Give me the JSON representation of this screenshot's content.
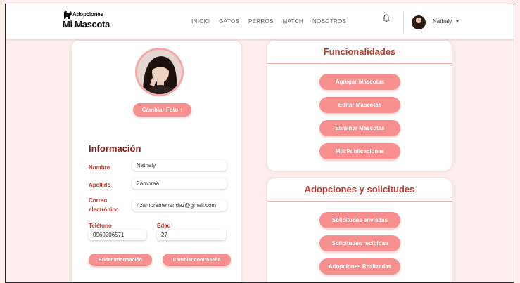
{
  "header": {
    "logo_top": "Adopciones",
    "logo_main": "Mi Mascota",
    "nav": [
      "INICIO",
      "GATOS",
      "PERROS",
      "MATCH",
      "NOSOTROS"
    ],
    "username": "Nathaly",
    "caret": "▾"
  },
  "profile": {
    "change_photo": "Cambiar Foto ↑",
    "section_title": "Información",
    "fields": {
      "nombre_label": "Nombre",
      "nombre_value": "Nathaly",
      "apellido_label": "Apellido",
      "apellido_value": "Zamoraa",
      "correo_label": "Correo electrónico",
      "correo_value": "nzamoramenendez@gmail.com",
      "telefono_label": "Teléfono",
      "telefono_value": "0960206571",
      "edad_label": "Edad",
      "edad_value": "27"
    },
    "edit_button": "Editar Información",
    "password_button": "Cambiar contraseña"
  },
  "funcionalidades": {
    "title": "Funcionalidades",
    "buttons": [
      "Agregar Mascotas",
      "Editar Mascotas",
      "Eliminar Mascotas",
      "Mis Publicaciones"
    ]
  },
  "adopciones": {
    "title": "Adopciones y solicitudes",
    "buttons": [
      "Solicitudes enviadas",
      "Solicitudes recibidas",
      "Adopciones Realizadas"
    ]
  },
  "colors": {
    "accent": "#f68f8e",
    "title_red": "#c0392b",
    "background": "#fdeeed"
  },
  "icons": [
    "dog-logo-icon",
    "bell-icon",
    "chevron-down-icon",
    "upload-icon"
  ]
}
